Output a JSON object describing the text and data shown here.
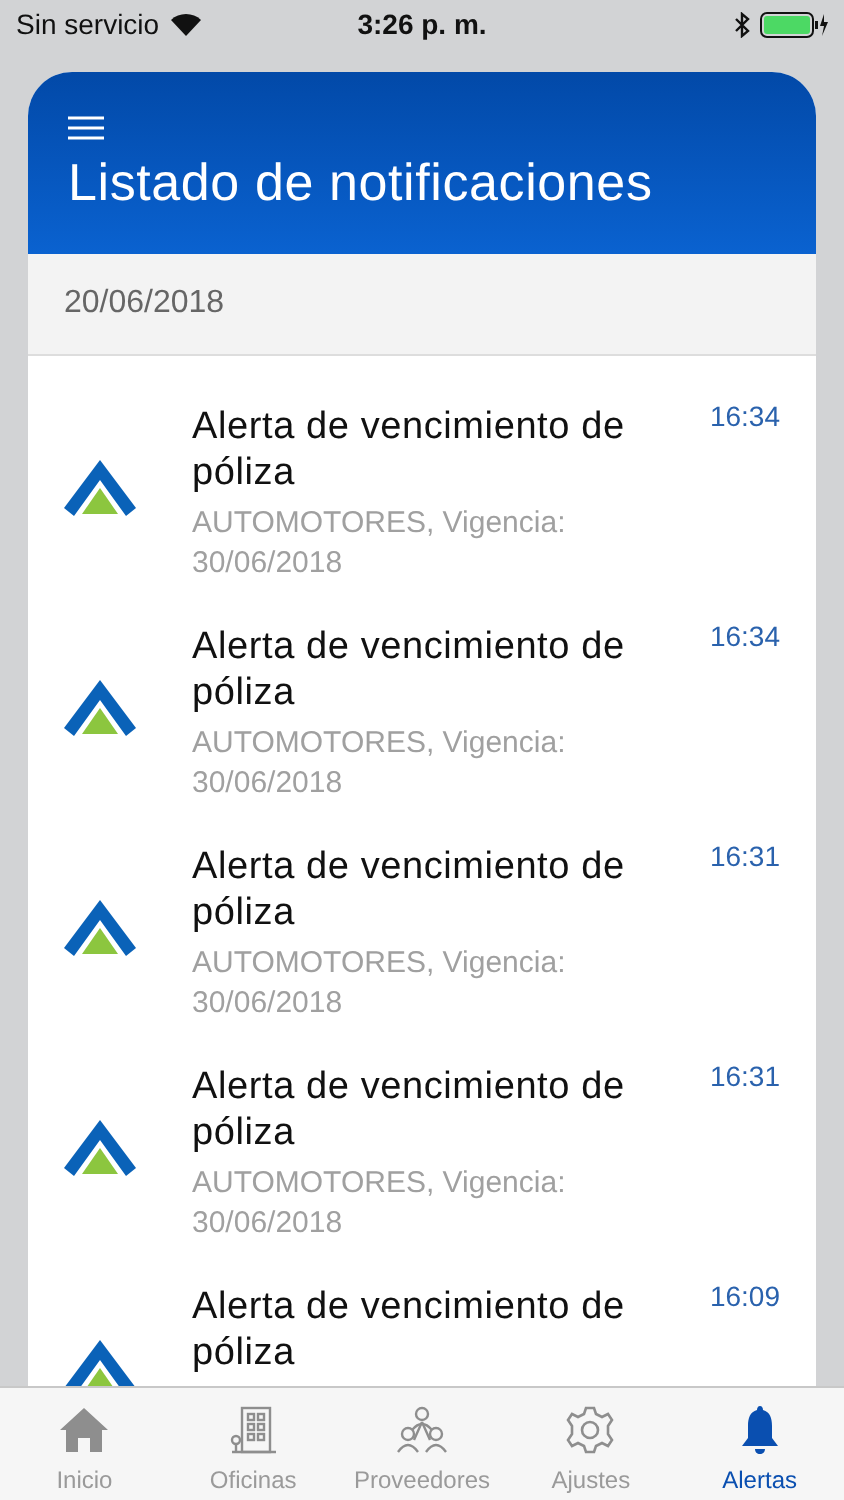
{
  "status_bar": {
    "carrier": "Sin servicio",
    "time": "3:26 p. m."
  },
  "header": {
    "title": "Listado de notificaciones"
  },
  "date_header": "20/06/2018",
  "notifications": [
    {
      "title": "Alerta de vencimiento de póliza",
      "subtitle": "AUTOMOTORES, Vigencia: 30/06/2018",
      "time": "16:34"
    },
    {
      "title": "Alerta de vencimiento de póliza",
      "subtitle": "AUTOMOTORES, Vigencia: 30/06/2018",
      "time": "16:34"
    },
    {
      "title": "Alerta de vencimiento de póliza",
      "subtitle": "AUTOMOTORES, Vigencia: 30/06/2018",
      "time": "16:31"
    },
    {
      "title": "Alerta de vencimiento de póliza",
      "subtitle": "AUTOMOTORES, Vigencia: 30/06/2018",
      "time": "16:31"
    },
    {
      "title": "Alerta de vencimiento de póliza",
      "time": "16:09"
    }
  ],
  "tabs": [
    {
      "kind": "home",
      "label": "Inicio",
      "selected": false
    },
    {
      "kind": "building",
      "label": "Oficinas",
      "selected": false
    },
    {
      "kind": "people",
      "label": "Proveedores",
      "selected": false
    },
    {
      "kind": "gear",
      "label": "Ajustes",
      "selected": false
    },
    {
      "kind": "bell",
      "label": "Alertas",
      "selected": true
    }
  ]
}
